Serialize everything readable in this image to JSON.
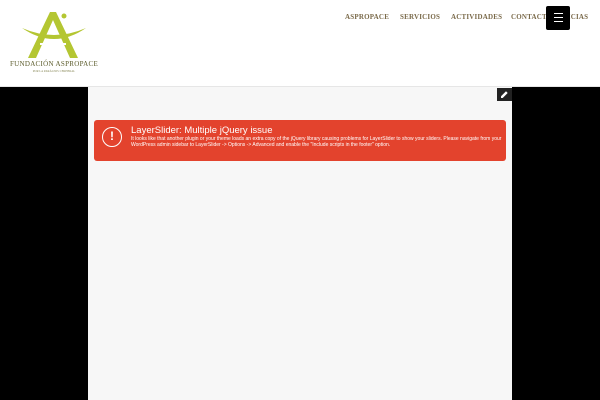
{
  "brand": {
    "name": "FUNDACIÓN ASPROPACE",
    "tagline": "POR LA PARÁLISIS CEREBRAL",
    "logo_color": "#b4c632"
  },
  "nav": {
    "items": [
      "ASPROPACE",
      "SERVICIOS",
      "ACTIVIDADES",
      "CONTACTO",
      "NOTICIAS"
    ],
    "menu_icon": "hamburger-icon"
  },
  "toolbar": {
    "edit_icon": "pencil-icon"
  },
  "alert": {
    "icon": "!",
    "title": "LayerSlider: Multiple jQuery issue",
    "message": "It looks like that another plugin or your theme loads an extra copy of the jQuery library causing problems for LayerSlider to show your sliders. Please navigate from your WordPress admin sidebar to LayerSlider -> Options -> Advanced and enable the \"Include scripts in the footer\" option.",
    "color": "#e3432d"
  }
}
